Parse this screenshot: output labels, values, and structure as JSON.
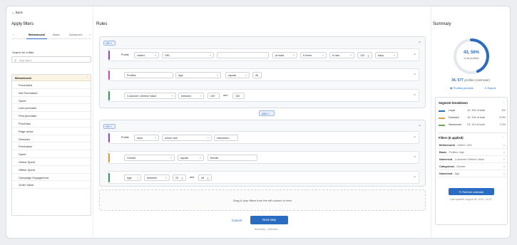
{
  "back_label": "Back",
  "left": {
    "title": "Apply filters",
    "tabs": [
      "Behavioural",
      "Basic",
      "Advanced"
    ],
    "search_label": "Search for a filter",
    "search_placeholder": "Any input",
    "group": "Behavioural",
    "items": [
      "Purchased",
      "Not Purchased",
      "Spent",
      "Last purchase",
      "First purchase",
      "Purchase",
      "Page views",
      "Sessions",
      "Purchases",
      "Spent",
      "Online Spent",
      "Offline Spent",
      "Campaign Engagement",
      "Order Value"
    ]
  },
  "rules": {
    "title": "Rules",
    "or_label": "OR",
    "and_label": "AND",
    "block1": {
      "row1": {
        "a": "Profile",
        "b": "visited",
        "c": "URL",
        "d": "",
        "e": "at least",
        "f": "5 times",
        "g": "in last",
        "h": "120",
        "i": "days"
      },
      "row2": {
        "a": "Profiles",
        "b": "Age",
        "c": "equals",
        "d": "45"
      },
      "row3": {
        "a": "Customer Lifetime Value",
        "b": "between",
        "c": "100",
        "d": "and",
        "e": "150"
      }
    },
    "block2": {
      "row1": {
        "a": "Profile",
        "b": "have",
        "c": "online visit",
        "d": "interaction"
      },
      "row2": {
        "a": "Gender",
        "b": "equals",
        "c": "female"
      },
      "row3": {
        "a": "Age",
        "b": "between",
        "c": "23",
        "d": "and",
        "e": "45"
      }
    },
    "drop_text": "Drag & drop filters from the left column to here",
    "cancel": "Cancel",
    "next": "Next step",
    "step_text": "Summary - Overview"
  },
  "summary": {
    "title": "Summary",
    "pct": "43, 56%",
    "pct_value": 43.56,
    "pct_sub": "of all profiles",
    "profiles_num": "34, 577",
    "profiles_txt": "profiles (estimate)",
    "preview": "Profiles preview",
    "export": "Export",
    "seg_title": "Segment breakdown",
    "segments": [
      {
        "name": "Loyal",
        "total": "12, 304 of total",
        "pct": "4%",
        "color": "#2a6cc1"
      },
      {
        "name": "Dormant",
        "total": "16, 204 of total",
        "pct": "5,5%",
        "color": "#e0a040"
      },
      {
        "name": "Newcomer",
        "total": "23, 111 of total",
        "pct": "7,2%",
        "color": "#6aa84f"
      }
    ],
    "filters_title": "Filters (6 applied)",
    "filters": [
      {
        "k": "Behavioural",
        "v": "- Visited, URL"
      },
      {
        "k": "Basic",
        "v": "- Profiles, Age"
      },
      {
        "k": "Numerical",
        "v": "- Customer Lifetime Value"
      },
      {
        "k": "Categorical",
        "v": "- Gender"
      },
      {
        "k": "Numerical",
        "v": "- Age"
      }
    ],
    "refresh": "Refresh estimate",
    "updated": "Last updated: August 05, 2024, 14:23"
  }
}
